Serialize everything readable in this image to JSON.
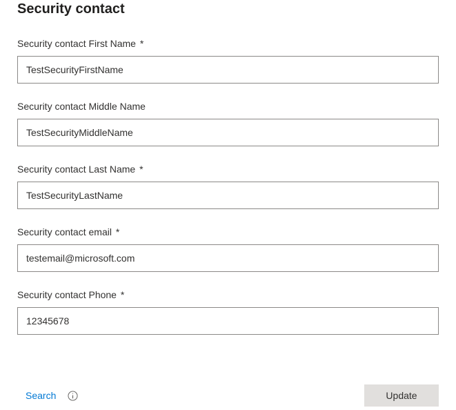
{
  "page": {
    "title": "Security contact"
  },
  "fields": {
    "firstName": {
      "label": "Security contact First Name",
      "required": "*",
      "value": "TestSecurityFirstName"
    },
    "middleName": {
      "label": "Security contact Middle Name",
      "required": "",
      "value": "TestSecurityMiddleName"
    },
    "lastName": {
      "label": "Security contact Last Name",
      "required": "*",
      "value": "TestSecurityLastName"
    },
    "email": {
      "label": "Security contact email",
      "required": "*",
      "value": "testemail@microsoft.com"
    },
    "phone": {
      "label": "Security contact Phone",
      "required": "*",
      "value": "12345678"
    }
  },
  "footer": {
    "searchLabel": "Search",
    "updateLabel": "Update"
  }
}
